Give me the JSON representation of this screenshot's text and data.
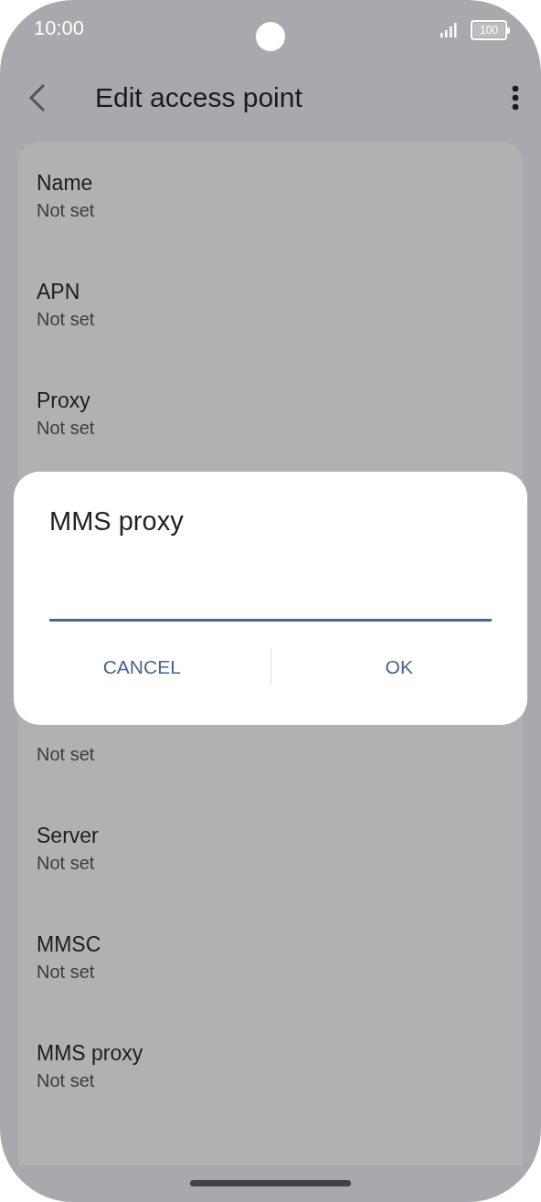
{
  "status_bar": {
    "time": "10:00",
    "battery": "100"
  },
  "header": {
    "title": "Edit access point"
  },
  "settings": [
    {
      "label": "Name",
      "value": "Not set"
    },
    {
      "label": "APN",
      "value": "Not set"
    },
    {
      "label": "Proxy",
      "value": "Not set"
    },
    {
      "value": "Not set"
    },
    {
      "label": "Server",
      "value": "Not set"
    },
    {
      "label": "MMSC",
      "value": "Not set"
    },
    {
      "label": "MMS proxy",
      "value": "Not set"
    }
  ],
  "dialog": {
    "title": "MMS proxy",
    "buttons": [
      "CANCEL",
      "OK"
    ]
  }
}
